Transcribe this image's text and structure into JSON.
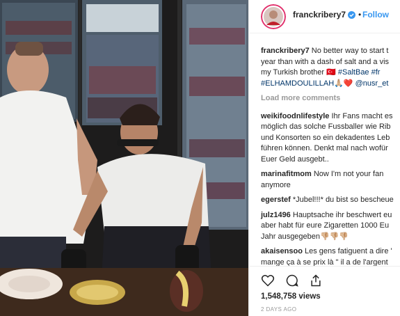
{
  "post": {
    "author": "franckribery7",
    "follow_label": "Follow",
    "separator": "•",
    "caption": {
      "username": "franckribery7",
      "line1": "No better way to start t",
      "line2": "year than with a dash of salt and a vis",
      "line3_text": "my Turkish brother 🇹🇷 ",
      "line3_tags": "#SaltBae #fr",
      "line4_tags": "#ELHAMDOULILLAH",
      "line4_text": "🙏🏼❤️ ",
      "line4_mention": "@nusr_et"
    },
    "load_more": "Load more comments",
    "comments": [
      {
        "username": "weikifoodnlifestyle",
        "first": "Ihr Fans macht es",
        "lines": [
          "möglich das solche Fussballer wie Rib",
          "und Konsorten so ein dekadentes Leb",
          "führen können. Denkt mal nach wofür",
          "Euer Geld ausgebt.."
        ]
      },
      {
        "username": "marinafitmom",
        "first": "Now I'm not your fan",
        "lines": [
          "anymore"
        ]
      },
      {
        "username": "egerstef",
        "first": "*Jubel!!!* du bist so bescheue",
        "lines": []
      },
      {
        "username": "julz1496",
        "first": "Hauptsache ihr beschwert eu",
        "lines": [
          "aber habt für eure Zigaretten 1000 Eu",
          "Jahr ausgegeben👎🏼👎🏼👎🏼"
        ]
      },
      {
        "username": "akaisensoo",
        "first": "Les gens fatiguent a dire '",
        "lines": [
          "mange ça à se prix là \" il a de l'argent"
        ]
      }
    ],
    "views": "1,548,758 views",
    "timestamp": "2 DAYS AGO"
  },
  "icons": [
    "verified-badge-icon",
    "heart-icon",
    "comment-icon",
    "share-icon"
  ],
  "colors": {
    "link": "#3897f0",
    "hashtag": "#003569",
    "muted": "#999999",
    "text": "#262626"
  }
}
